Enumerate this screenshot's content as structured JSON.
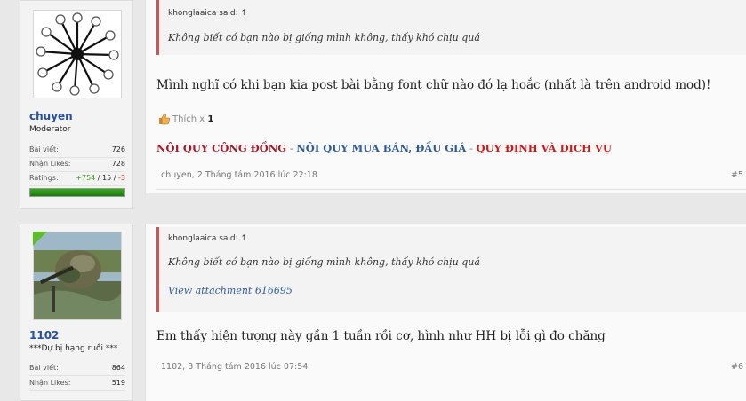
{
  "posts": [
    {
      "user": {
        "name": "chuyen",
        "title": "Moderator",
        "stats": [
          {
            "label": "Bài viết:",
            "value": "726"
          },
          {
            "label": "Nhận Likes:",
            "value": "728"
          }
        ],
        "ratings": {
          "label": "Ratings:",
          "pos": "+754",
          "sep1": " / ",
          "neu": "15",
          "sep2": " / ",
          "neg": "-3"
        },
        "bar_level": 1.0
      },
      "quote": {
        "author": "khonglaaica said: ↑",
        "text": "Không biết có bạn nào bị giống mình không, thấy khó chịu quá"
      },
      "message": "Mình nghĩ có khi bạn kia post bài bằng font chữ nào đó lạ hoắc (nhất là trên android mod)!",
      "likes": {
        "label": "Thích",
        "x": "x",
        "count": "1"
      },
      "rules": {
        "a": "NỘI QUY CỘNG ĐỒNG",
        "sep1": " - ",
        "b": "NỘI QUY MUA BÁN, ĐẤU GIÁ",
        "sep2": " - ",
        "c": "QUY ĐỊNH VÀ DỊCH VỤ"
      },
      "meta": "chuyen, 2 Tháng tám 2016 lúc 22:18",
      "number": "#5"
    },
    {
      "user": {
        "name": "1102",
        "title": "***Dự bị hạng ruồi ***",
        "stats": [
          {
            "label": "Bài viết:",
            "value": "864"
          },
          {
            "label": "Nhận Likes:",
            "value": "519"
          }
        ]
      },
      "quote": {
        "author": "khonglaaica said: ↑",
        "text": "Không biết có bạn nào bị giống mình không, thấy khó chịu quá",
        "attachment": "View attachment 616695"
      },
      "message": "Em thấy hiện tượng này gần 1 tuần rồi cơ, hình như HH bị lỗi gì đo chăng",
      "meta": "1102, 3 Tháng tám 2016 lúc 07:54",
      "number": "#6"
    }
  ],
  "colors": {
    "accent_blue": "#2850a0",
    "quote_border": "#cc5555",
    "rule_red": "#a51a2a",
    "rule_blue": "#2f5a9a",
    "bar_green": "#3aa820"
  },
  "icons": {
    "like": "thumbs-up-icon",
    "avatar1": "network-logo",
    "avatar2": "camo-soldier-photo"
  }
}
